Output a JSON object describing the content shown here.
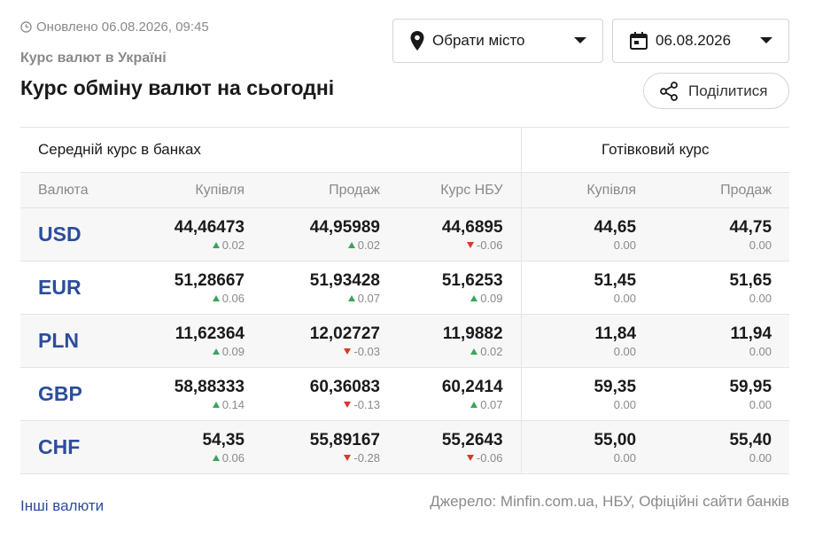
{
  "header": {
    "updated_text": "Оновлено 06.08.2026, 09:45",
    "subtitle": "Курс валют в Україні",
    "title": "Курс обміну валют на сьогодні"
  },
  "controls": {
    "city_select": "Обрати місто",
    "date_select": "06.08.2026",
    "share_label": "Поділитися"
  },
  "table": {
    "group_bank": "Середній курс в банках",
    "group_cash": "Готівковий курс",
    "columns": [
      "Валюта",
      "Купівля",
      "Продаж",
      "Курс НБУ",
      "Купівля",
      "Продаж"
    ],
    "rows": [
      {
        "code": "USD",
        "cells": [
          {
            "value": "44,46473",
            "change": "0.02",
            "dir": "up"
          },
          {
            "value": "44,95989",
            "change": "0.02",
            "dir": "up"
          },
          {
            "value": "44,6895",
            "change": "-0.06",
            "dir": "down"
          },
          {
            "value": "44,65",
            "change": "0.00",
            "dir": "none"
          },
          {
            "value": "44,75",
            "change": "0.00",
            "dir": "none"
          }
        ]
      },
      {
        "code": "EUR",
        "cells": [
          {
            "value": "51,28667",
            "change": "0.06",
            "dir": "up"
          },
          {
            "value": "51,93428",
            "change": "0.07",
            "dir": "up"
          },
          {
            "value": "51,6253",
            "change": "0.09",
            "dir": "up"
          },
          {
            "value": "51,45",
            "change": "0.00",
            "dir": "none"
          },
          {
            "value": "51,65",
            "change": "0.00",
            "dir": "none"
          }
        ]
      },
      {
        "code": "PLN",
        "cells": [
          {
            "value": "11,62364",
            "change": "0.09",
            "dir": "up"
          },
          {
            "value": "12,02727",
            "change": "-0.03",
            "dir": "down"
          },
          {
            "value": "11,9882",
            "change": "0.02",
            "dir": "up"
          },
          {
            "value": "11,84",
            "change": "0.00",
            "dir": "none"
          },
          {
            "value": "11,94",
            "change": "0.00",
            "dir": "none"
          }
        ]
      },
      {
        "code": "GBP",
        "cells": [
          {
            "value": "58,88333",
            "change": "0.14",
            "dir": "up"
          },
          {
            "value": "60,36083",
            "change": "-0.13",
            "dir": "down"
          },
          {
            "value": "60,2414",
            "change": "0.07",
            "dir": "up"
          },
          {
            "value": "59,35",
            "change": "0.00",
            "dir": "none"
          },
          {
            "value": "59,95",
            "change": "0.00",
            "dir": "none"
          }
        ]
      },
      {
        "code": "CHF",
        "cells": [
          {
            "value": "54,35",
            "change": "0.06",
            "dir": "up"
          },
          {
            "value": "55,89167",
            "change": "-0.28",
            "dir": "down"
          },
          {
            "value": "55,2643",
            "change": "-0.06",
            "dir": "down"
          },
          {
            "value": "55,00",
            "change": "0.00",
            "dir": "none"
          },
          {
            "value": "55,40",
            "change": "0.00",
            "dir": "none"
          }
        ]
      }
    ]
  },
  "footer": {
    "other_link": "Інші валюти",
    "source": "Джерело: Minfin.com.ua, НБУ, Офіційні сайти банків"
  },
  "colors": {
    "link": "#2b4d9b",
    "up": "#3aa55a",
    "down": "#d9382b",
    "muted": "#8a8a8a"
  }
}
